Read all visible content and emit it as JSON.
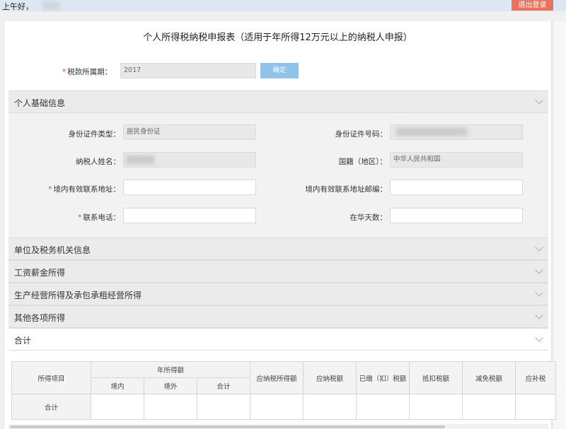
{
  "header": {
    "greeting": "上午好，",
    "logout_label": "退出登录"
  },
  "form": {
    "title": "个人所得税纳税申报表（适用于年所得12万元以上的纳税人申报）",
    "tax_period": {
      "label": "税款所属期：",
      "value": "2017",
      "required_mark": "*"
    },
    "confirm_label": "确定"
  },
  "sections": {
    "basic": "个人基础信息",
    "unit": "单位及税务机关信息",
    "wages": "工资薪金所得",
    "business": "生产经营所得及承包承租经营所得",
    "other": "其他各项所得",
    "total": "合计"
  },
  "basic_info": {
    "id_type": {
      "label": "身份证件类型：",
      "value": "居民身份证"
    },
    "id_number": {
      "label": "身份证件号码：",
      "value": ""
    },
    "name": {
      "label": "纳税人姓名：",
      "value": ""
    },
    "nationality": {
      "label": "国籍（地区）：",
      "value": "中华人民共和国"
    },
    "address": {
      "label": "境内有效联系地址：",
      "value": "",
      "required_mark": "*"
    },
    "postcode": {
      "label": "境内有效联系地址邮编：",
      "value": ""
    },
    "phone": {
      "label": "联系电话：",
      "value": "",
      "required_mark": "*"
    },
    "days_in_china": {
      "label": "在华天数：",
      "value": ""
    }
  },
  "summary_table": {
    "item_header": "所得项目",
    "annual_income_header": "年所得额",
    "domestic": "境内",
    "overseas": "境外",
    "subtotal": "合计",
    "taxable_income": "应纳税所得额",
    "tax_payable": "应纳税额",
    "tax_paid": "已缴（扣）税额",
    "tax_credit": "抵扣税额",
    "tax_relief": "减免税额",
    "tax_due": "应补税",
    "row_label": "合计"
  },
  "colors": {
    "logout_bg": "#e8735a",
    "confirm_bg": "#8fc3ea",
    "required": "#e04a3a",
    "section_bg": "#ebebeb"
  }
}
